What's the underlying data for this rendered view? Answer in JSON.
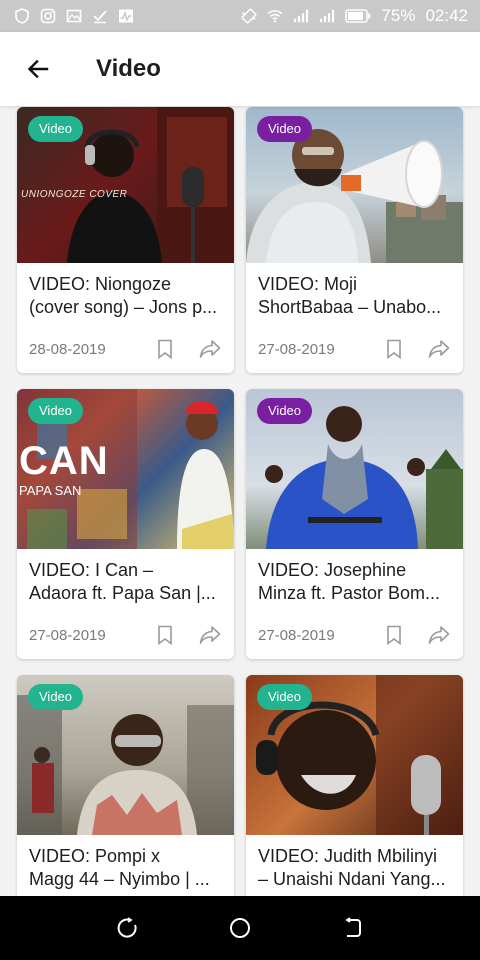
{
  "status_bar": {
    "battery": "75%",
    "time": "02:42",
    "icons": [
      "shield-icon",
      "instagram-icon",
      "image-icon",
      "check-icon",
      "activity-icon",
      "vibrate-icon",
      "wifi-icon",
      "signal-icon",
      "signal-icon",
      "battery-icon"
    ]
  },
  "app_bar": {
    "title": "Video",
    "back_icon": "arrow-left-icon"
  },
  "colors": {
    "badge_green": "#21b48e",
    "badge_purple": "#7a1fa2"
  },
  "videos": [
    {
      "badge": "Video",
      "badge_color": "green",
      "title_line1": "VIDEO: Niongoze",
      "title_line2": "(cover song) – Jons p...",
      "date": "28-08-2019",
      "thumb_caption": "UNIONGOZE COVER"
    },
    {
      "badge": "Video",
      "badge_color": "purple",
      "title_line1": "VIDEO: Moji",
      "title_line2": "ShortBabaa – Unabo...",
      "date": "27-08-2019"
    },
    {
      "badge": "Video",
      "badge_color": "green",
      "title_line1": "VIDEO: I Can –",
      "title_line2": "Adaora ft. Papa San |...",
      "date": "27-08-2019",
      "thumb_caption": "CAN",
      "thumb_caption2": "PAPA SAN"
    },
    {
      "badge": "Video",
      "badge_color": "purple",
      "title_line1": "VIDEO: Josephine",
      "title_line2": "Minza ft. Pastor Bom...",
      "date": "27-08-2019"
    },
    {
      "badge": "Video",
      "badge_color": "green",
      "title_line1": "VIDEO: Pompi x",
      "title_line2": "Magg 44 – Nyimbo | ...",
      "date": ""
    },
    {
      "badge": "Video",
      "badge_color": "green",
      "title_line1": "VIDEO: Judith Mbilinyi",
      "title_line2": "– Unaishi Ndani Yang...",
      "date": ""
    }
  ],
  "nav_bar": {
    "icons": [
      "recents-icon",
      "home-icon",
      "back-icon"
    ]
  }
}
